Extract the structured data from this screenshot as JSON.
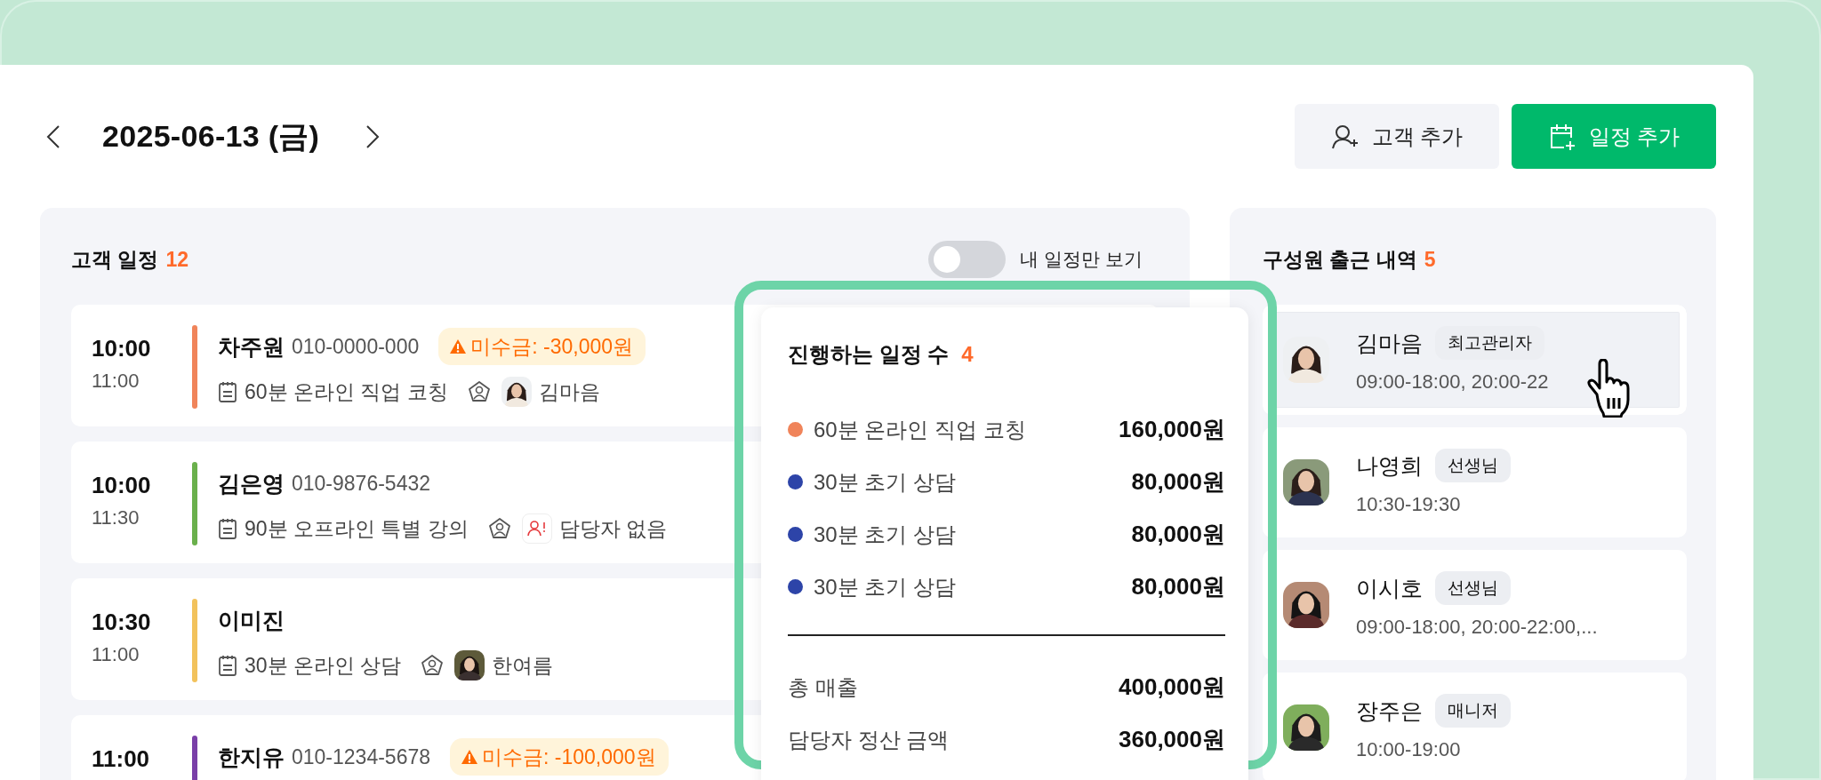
{
  "date_nav": {
    "date": "2025-06-13 (금)"
  },
  "actions": [
    {
      "label": "고객 추가",
      "kind": "secondary"
    },
    {
      "label": "일정 추가",
      "kind": "primary"
    }
  ],
  "schedule": {
    "title": "고객 일정",
    "count": "12",
    "toggle": {
      "label": "내 일정만 보기",
      "on": false
    },
    "items": [
      {
        "start": "10:00",
        "end": "11:00",
        "color": "#f0845a",
        "name": "차주원",
        "phone": "010-0000-000",
        "unpaid": "미수금: -30,000원",
        "service": "60분 온라인 직업 코칭",
        "staff": {
          "name": "김마음"
        }
      },
      {
        "start": "10:00",
        "end": "11:30",
        "color": "#6ab04c",
        "name": "김은영",
        "phone": "010-9876-5432",
        "service": "90분 오프라인 특별 강의",
        "staff": {
          "name": "담당자 없음",
          "kind": "none"
        }
      },
      {
        "start": "10:30",
        "end": "11:00",
        "color": "#f2c25c",
        "name": "이미진",
        "service": "30분 온라인 상담",
        "staff": {
          "name": "한여름"
        }
      },
      {
        "start": "11:00",
        "color": "#7a3fa8",
        "name": "한지유",
        "phone": "010-1234-5678",
        "unpaid": "미수금: -100,000원"
      }
    ]
  },
  "summary": {
    "title": "진행하는 일정 수",
    "count": "4",
    "items": [
      {
        "label": "60분 온라인 직업 코칭",
        "amount": "160,000원",
        "color": "#f0845a"
      },
      {
        "label": "30분 초기 상담",
        "amount": "80,000원",
        "color": "#2d44a8"
      },
      {
        "label": "30분 초기 상담",
        "amount": "80,000원",
        "color": "#2d44a8"
      },
      {
        "label": "30분 초기 상담",
        "amount": "80,000원",
        "color": "#2d44a8"
      }
    ],
    "totals": [
      {
        "label": "총 매출",
        "amount": "400,000원"
      },
      {
        "label": "담당자 정산 금액",
        "amount": "360,000원"
      }
    ]
  },
  "members": {
    "title": "구성원 출근 내역",
    "count": "5",
    "items": [
      {
        "name": "김마음",
        "role": "최고관리자",
        "hours": "09:00-18:00, 20:00-22",
        "hovered": true
      },
      {
        "name": "나영희",
        "role": "선생님",
        "hours": "10:30-19:30",
        "hovered": false
      },
      {
        "name": "이시호",
        "role": "선생님",
        "hours": "09:00-18:00, 20:00-22:00,...",
        "hovered": false
      },
      {
        "name": "장주은",
        "role": "매니저",
        "hours": "10:00-19:00",
        "hovered": false
      }
    ]
  }
}
